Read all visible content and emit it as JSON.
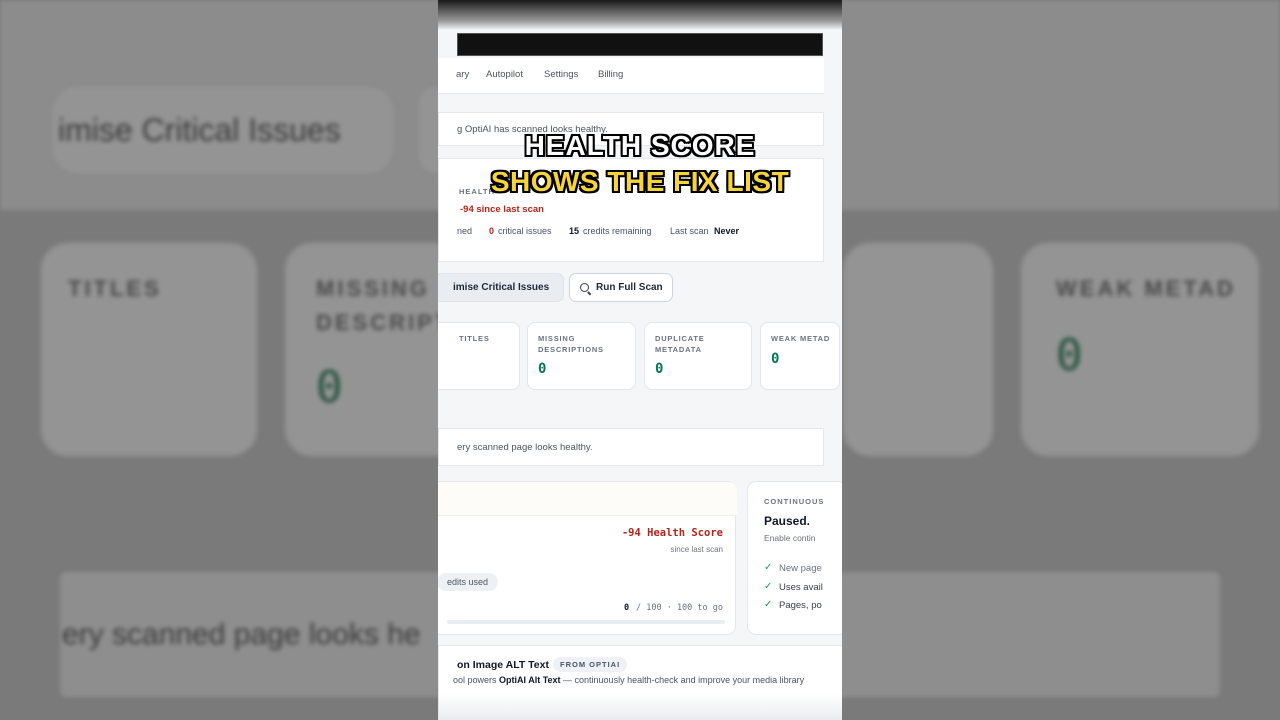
{
  "overlay": {
    "line1": "HEALTH SCORE",
    "line2": "SHOWS THE FIX LIST"
  },
  "nav": {
    "items": [
      "ary",
      "Autopilot",
      "Settings",
      "Billing"
    ]
  },
  "banner": {
    "text": "g OptiAI has scanned looks healthy."
  },
  "health": {
    "label": "HEALTH",
    "delta": "-94 since last scan",
    "summary": {
      "scanned_label": "ned",
      "critical_count": "0",
      "critical_label": "critical issues",
      "credits_count": "15",
      "credits_label": "credits remaining",
      "last_scan_label": "Last scan",
      "last_scan_value": "Never"
    }
  },
  "actions": {
    "optimise": "imise Critical Issues",
    "run_scan": "Run Full Scan"
  },
  "stats": [
    {
      "label": "TITLES",
      "value": ""
    },
    {
      "label": "MISSING DESCRIPTIONS",
      "value": "0"
    },
    {
      "label": "DUPLICATE METADATA",
      "value": "0"
    },
    {
      "label": "WEAK METAD",
      "value": "0"
    }
  ],
  "healthy_note": "ery scanned page looks healthy.",
  "score_card": {
    "score": "-94 Health Score",
    "since": "since last scan",
    "credits_used": "edits used",
    "progress_current": "0",
    "progress_rest": "/ 100 · 100 to go",
    "progress_fraction": 0
  },
  "continuous": {
    "label": "CONTINUOUS",
    "status": "Paused.",
    "desc": "Enable contin",
    "items": [
      "New page",
      "Uses avail",
      "Pages, po"
    ]
  },
  "alt_text": {
    "title": "on Image ALT Text",
    "badge": "FROM OPTIAI",
    "desc_prefix": "ool powers ",
    "desc_bold": "OptiAI Alt Text",
    "desc_suffix": " — continuously health-check and improve your media library"
  },
  "background": {
    "heading": "imise Critical Issues",
    "stat1": "TITLES",
    "stat2a": "MISSING",
    "stat2b": "DESCRIPT",
    "stat3": "WEAK METAD",
    "value2": "0",
    "value3": "0",
    "footer": "ery scanned page looks he"
  },
  "colors": {
    "accent_green": "#047857",
    "alert_red": "#b42318",
    "overlay_yellow": "#f6d43a"
  }
}
